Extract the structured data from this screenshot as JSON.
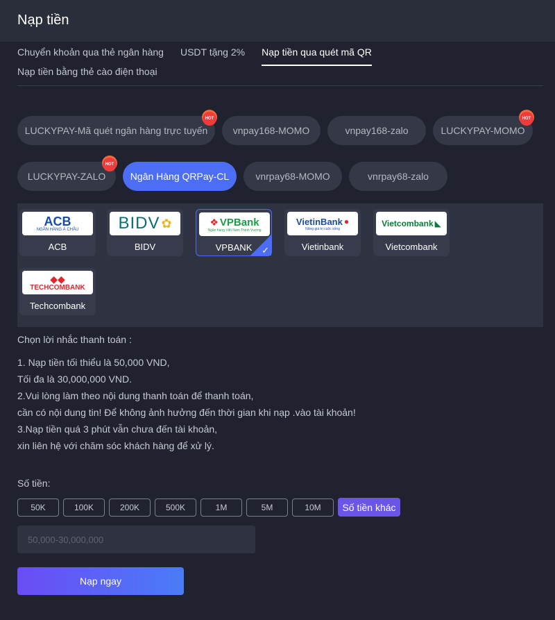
{
  "header": {
    "title": "Nạp tiền"
  },
  "tabs": [
    {
      "label": "Chuyển khoản qua thẻ ngân hàng"
    },
    {
      "label": "USDT tặng 2%"
    },
    {
      "label": "Nạp tiền qua quét mã QR"
    },
    {
      "label": "Nạp tiền bằng thẻ cào điện thoại"
    }
  ],
  "channels": [
    {
      "label": "LUCKYPAY-Mã quét ngân hàng trực tuyến",
      "hot": true
    },
    {
      "label": "vnpay168-MOMO"
    },
    {
      "label": "vnpay168-zalo"
    },
    {
      "label": "LUCKYPAY-MOMO",
      "hot": true
    },
    {
      "label": "LUCKYPAY-ZALO",
      "hot": true
    },
    {
      "label": "Ngân Hàng QRPay-CL",
      "active": true
    },
    {
      "label": "vnrpay68-MOMO"
    },
    {
      "label": "vnrpay68-zalo"
    }
  ],
  "hot_badge": "HOT",
  "banks": [
    {
      "name": "ACB",
      "logo_text": "ACB",
      "logo_sub": "NGÂN HÀNG Á CHÂU",
      "color": "#1a4aa8"
    },
    {
      "name": "BIDV",
      "logo_text": "BIDV",
      "color": "#0a6e74"
    },
    {
      "name": "VPBANK",
      "logo_text": "VPBank",
      "logo_sub": "Ngân hàng Việt Nam Thịnh Vượng",
      "color": "#1f9a4a",
      "selected": true
    },
    {
      "name": "Vietinbank",
      "logo_text": "VietinBank",
      "logo_sub": "Nâng giá trị cuộc sống",
      "color": "#1a4c9c"
    },
    {
      "name": "Vietcombank",
      "logo_text": "Vietcombank",
      "color": "#0a7a3a"
    },
    {
      "name": "Techcombank",
      "logo_text": "TECHCOMBANK",
      "color": "#e0262b"
    }
  ],
  "reminder": {
    "title": "Chọn lời nhắc thanh toán :",
    "lines": [
      "1. Nạp tiền tối thiểu là 50,000 VND,",
      "Tối đa là 30,000,000 VND.",
      "2.Vui lòng làm theo nội dung thanh toán để thanh toán,",
      "cần có nội dung tin! Để không ảnh hưởng đến thời gian khi nạp .vào tài khoản!",
      "3.Nạp tiền quá 3 phút vẫn chưa đến tài khoản,",
      "xin liên hệ với chăm sóc khách hàng để xử lý."
    ]
  },
  "amount": {
    "label": "Số tiền:",
    "options": [
      "50K",
      "100K",
      "200K",
      "500K",
      "1M",
      "5M",
      "10M"
    ],
    "other_label": "Số tiền khác",
    "placeholder": "50,000-30,000,000"
  },
  "submit_label": "Nạp ngay",
  "colors": {
    "accent": "#4c6ef5",
    "purple": "#6a55e8",
    "hot": "#ef3b3b"
  }
}
